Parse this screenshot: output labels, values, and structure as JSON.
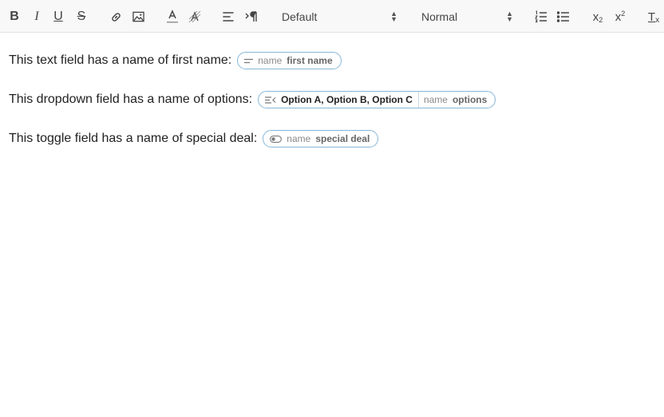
{
  "toolbar": {
    "bold": "B",
    "italic": "I",
    "underline": "U",
    "strike": "S",
    "font_select": "Default",
    "size_select": "Normal",
    "subscript": "x",
    "subscript_mark": "2",
    "superscript": "x",
    "superscript_mark": "2",
    "clear_format": "T"
  },
  "editor": {
    "lines": [
      {
        "text": "This text field has a name of first name:",
        "chip": {
          "icon": "text-field-icon",
          "name_label": "name",
          "name_value": "first name"
        }
      },
      {
        "text": "This dropdown field has a name of options:",
        "chip": {
          "icon": "dropdown-field-icon",
          "options": "Option A, Option B, Option C",
          "name_label": "name",
          "name_value": "options"
        }
      },
      {
        "text": "This toggle field has a name of special deal:",
        "chip": {
          "icon": "toggle-field-icon",
          "name_label": "name",
          "name_value": "special deal"
        }
      }
    ]
  },
  "colors": {
    "chip_border": "#88b7d8",
    "toolbar_bg": "#f8f8f8"
  }
}
